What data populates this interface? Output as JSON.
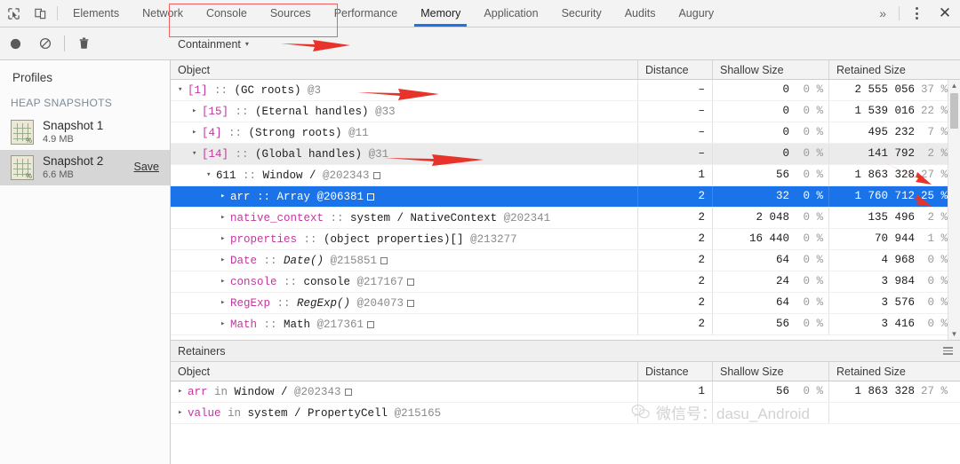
{
  "tabbar": {
    "icons": [
      "inspect-element-icon",
      "device-toolbar-icon"
    ],
    "tabs": [
      {
        "label": "Elements",
        "active": false
      },
      {
        "label": "Network",
        "active": false
      },
      {
        "label": "Console",
        "active": false
      },
      {
        "label": "Sources",
        "active": false
      },
      {
        "label": "Performance",
        "active": false
      },
      {
        "label": "Memory",
        "active": true
      },
      {
        "label": "Application",
        "active": false
      },
      {
        "label": "Security",
        "active": false
      },
      {
        "label": "Audits",
        "active": false
      },
      {
        "label": "Augury",
        "active": false
      }
    ],
    "more_label": "»",
    "close_label": "✕",
    "active_tab_color": "#1a73e8"
  },
  "toolbar": {
    "record_icon": "record-circle-icon",
    "clear_icon": "no-entry-icon",
    "trash_icon": "trash-icon",
    "view_select": "Containment",
    "view_caret": "▾",
    "highlight_color": "#f06060"
  },
  "sidebar": {
    "title": "Profiles",
    "section_header": "HEAP SNAPSHOTS",
    "snapshots": [
      {
        "name": "Snapshot 1",
        "size": "4.9 MB",
        "selected": false,
        "save_label": ""
      },
      {
        "name": "Snapshot 2",
        "size": "6.6 MB",
        "selected": true,
        "save_label": "Save"
      }
    ]
  },
  "grid": {
    "columns": [
      "Object",
      "Distance",
      "Shallow Size",
      "Retained Size"
    ]
  },
  "containment": {
    "rows": [
      {
        "indent": 0,
        "tri": "▾",
        "prefix": "[1]",
        "sep": "::",
        "type": "(GC roots)",
        "id": "@3",
        "box": false,
        "italic": false,
        "distance": "–",
        "shallow": "0",
        "shallow_pct": "0 %",
        "retained": "2 555 056",
        "retained_pct": "37 %",
        "selected": false,
        "alt": false
      },
      {
        "indent": 1,
        "tri": "▸",
        "prefix": "[15]",
        "sep": "::",
        "type": "(Eternal handles)",
        "id": "@33",
        "box": false,
        "italic": false,
        "distance": "–",
        "shallow": "0",
        "shallow_pct": "0 %",
        "retained": "1 539 016",
        "retained_pct": "22 %",
        "selected": false,
        "alt": false
      },
      {
        "indent": 1,
        "tri": "▸",
        "prefix": "[4]",
        "sep": "::",
        "type": "(Strong roots)",
        "id": "@11",
        "box": false,
        "italic": false,
        "distance": "–",
        "shallow": "0",
        "shallow_pct": "0 %",
        "retained": "495 232",
        "retained_pct": "7 %",
        "selected": false,
        "alt": false
      },
      {
        "indent": 1,
        "tri": "▾",
        "prefix": "[14]",
        "sep": "::",
        "type": "(Global handles)",
        "id": "@31",
        "box": false,
        "italic": false,
        "distance": "–",
        "shallow": "0",
        "shallow_pct": "0 %",
        "retained": "141 792",
        "retained_pct": "2 %",
        "selected": false,
        "alt": true
      },
      {
        "indent": 2,
        "tri": "▾",
        "prefix": "611",
        "sep": "::",
        "type": "Window /",
        "id": "@202343",
        "box": true,
        "italic": false,
        "distance": "1",
        "shallow": "56",
        "shallow_pct": "0 %",
        "retained": "1 863 328",
        "retained_pct": "27 %",
        "selected": false,
        "alt": false
      },
      {
        "indent": 3,
        "tri": "▸",
        "prefix": "arr",
        "sep": "::",
        "type": "Array",
        "id": "@206381",
        "box": true,
        "italic": false,
        "distance": "2",
        "shallow": "32",
        "shallow_pct": "0 %",
        "retained": "1 760 712",
        "retained_pct": "25 %",
        "selected": true,
        "alt": false
      },
      {
        "indent": 3,
        "tri": "▸",
        "prefix": "native_context",
        "sep": "::",
        "type": "system / NativeContext",
        "id": "@202341",
        "box": false,
        "italic": false,
        "distance": "2",
        "shallow": "2 048",
        "shallow_pct": "0 %",
        "retained": "135 496",
        "retained_pct": "2 %",
        "selected": false,
        "alt": false
      },
      {
        "indent": 3,
        "tri": "▸",
        "prefix": "properties",
        "sep": "::",
        "type": "(object properties)[]",
        "id": "@213277",
        "box": false,
        "italic": false,
        "distance": "2",
        "shallow": "16 440",
        "shallow_pct": "0 %",
        "retained": "70 944",
        "retained_pct": "1 %",
        "selected": false,
        "alt": false
      },
      {
        "indent": 3,
        "tri": "▸",
        "prefix": "Date",
        "sep": "::",
        "type": "Date()",
        "id": "@215851",
        "box": true,
        "italic": true,
        "distance": "2",
        "shallow": "64",
        "shallow_pct": "0 %",
        "retained": "4 968",
        "retained_pct": "0 %",
        "selected": false,
        "alt": false
      },
      {
        "indent": 3,
        "tri": "▸",
        "prefix": "console",
        "sep": "::",
        "type": "console",
        "id": "@217167",
        "box": true,
        "italic": false,
        "distance": "2",
        "shallow": "24",
        "shallow_pct": "0 %",
        "retained": "3 984",
        "retained_pct": "0 %",
        "selected": false,
        "alt": false
      },
      {
        "indent": 3,
        "tri": "▸",
        "prefix": "RegExp",
        "sep": "::",
        "type": "RegExp()",
        "id": "@204073",
        "box": true,
        "italic": true,
        "distance": "2",
        "shallow": "64",
        "shallow_pct": "0 %",
        "retained": "3 576",
        "retained_pct": "0 %",
        "selected": false,
        "alt": false
      },
      {
        "indent": 3,
        "tri": "▸",
        "prefix": "Math",
        "sep": "::",
        "type": "Math",
        "id": "@217361",
        "box": true,
        "italic": false,
        "distance": "2",
        "shallow": "56",
        "shallow_pct": "0 %",
        "retained": "3 416",
        "retained_pct": "0 %",
        "selected": false,
        "alt": false
      }
    ]
  },
  "retainers": {
    "title": "Retainers",
    "menu_icon": "hamburger-menu-icon",
    "rows": [
      {
        "indent": 0,
        "tri": "▸",
        "prefix": "arr",
        "sep": "in",
        "type": "Window /",
        "id": "@202343",
        "box": true,
        "italic": false,
        "distance": "1",
        "shallow": "56",
        "shallow_pct": "0 %",
        "retained": "1 863 328",
        "retained_pct": "27 %"
      },
      {
        "indent": 0,
        "tri": "▸",
        "prefix": "value",
        "sep": "in",
        "type": "system / PropertyCell",
        "id": "@215165",
        "box": false,
        "italic": false,
        "distance": "",
        "shallow": "",
        "shallow_pct": "",
        "retained": "",
        "retained_pct": ""
      }
    ]
  },
  "annotations": {
    "arrow_color": "#e8332a",
    "arrows": [
      "arrow-gc-roots",
      "arrow-global-handles",
      "arrow-containment",
      "arrow-window-pct",
      "arrow-arr-pct"
    ]
  },
  "watermark": {
    "icon": "wechat-icon",
    "text": "微信号：dasu_Android"
  }
}
